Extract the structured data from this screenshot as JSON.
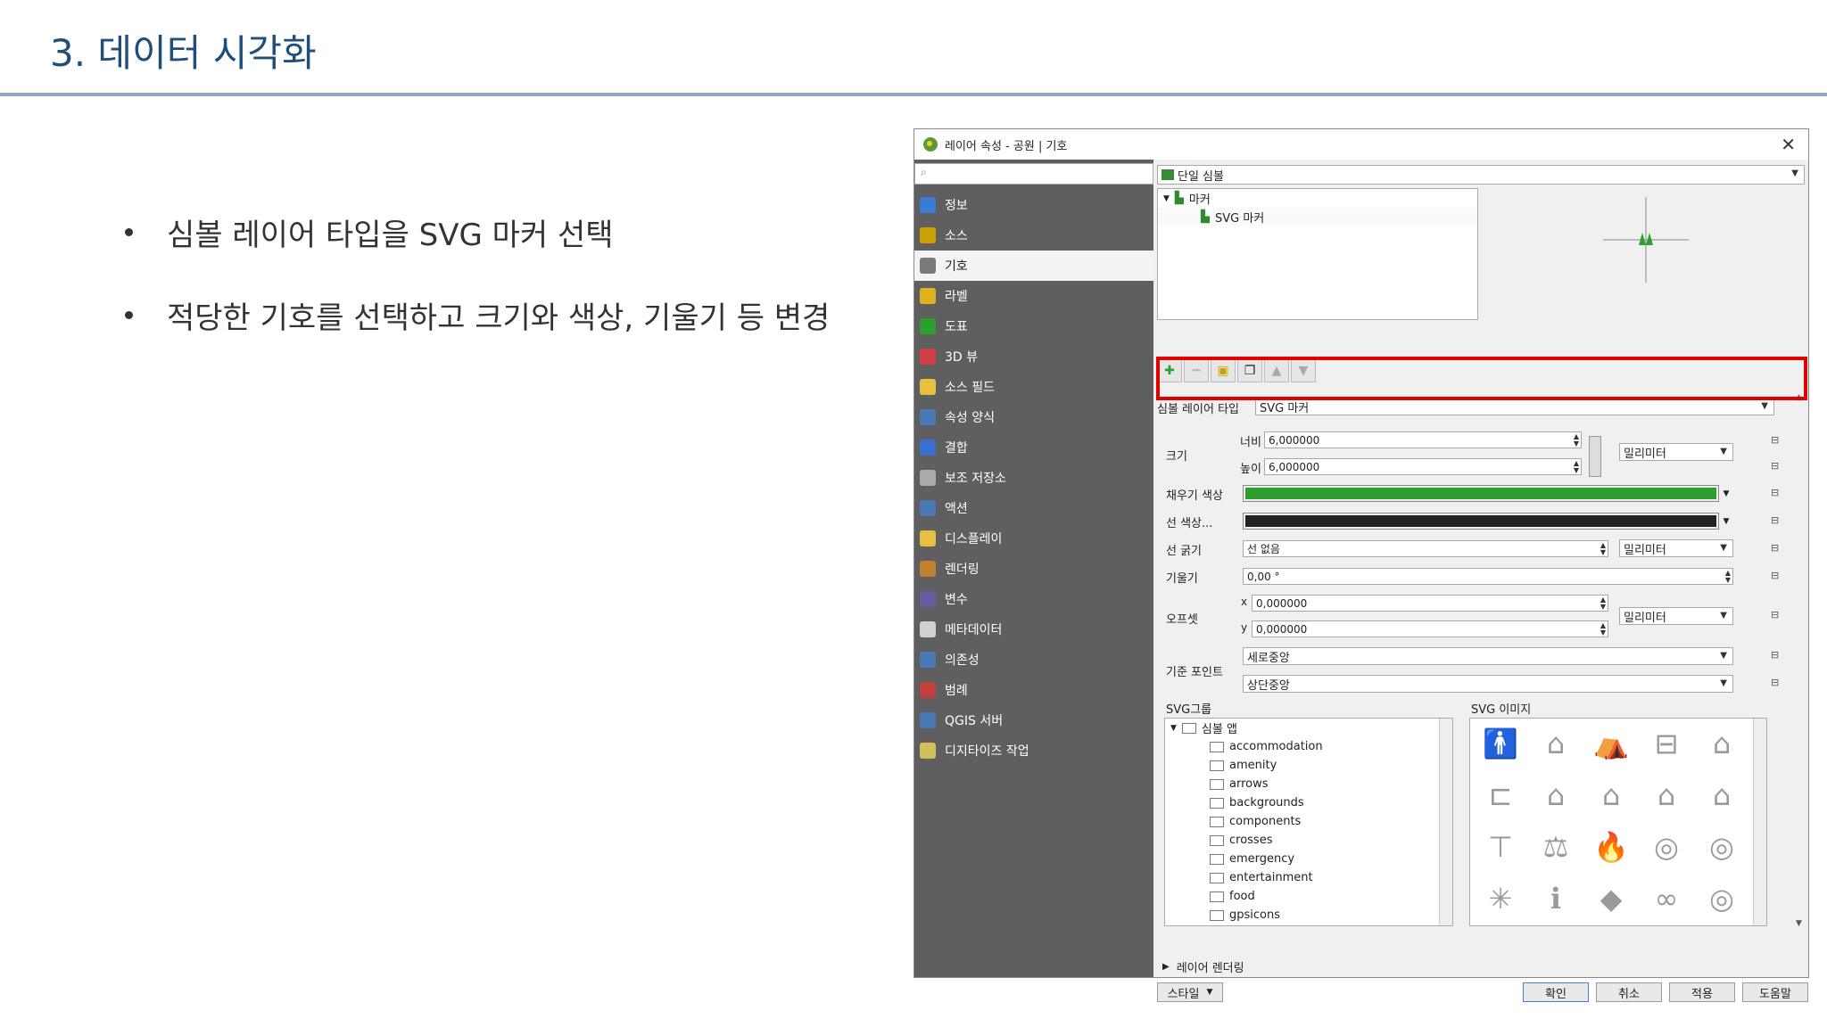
{
  "slide": {
    "title": "3. 데이터 시각화",
    "bullets": [
      "심볼 레이어 타입을 SVG 마커 선택",
      "적당한 기호를 선택하고 크기와 색상, 기울기 등 변경"
    ]
  },
  "dialog": {
    "title": "레이어 속성 - 공원 | 기호",
    "sidebar": [
      "정보",
      "소스",
      "기호",
      "라벨",
      "도표",
      "3D 뷰",
      "소스 필드",
      "속성 양식",
      "결합",
      "보조 저장소",
      "액션",
      "디스플레이",
      "렌더링",
      "변수",
      "메타데이터",
      "의존성",
      "범례",
      "QGIS 서버",
      "디지타이즈 작업"
    ],
    "active_index": 2,
    "renderer": "단일 심볼",
    "tree": {
      "root": "마커",
      "child": "SVG 마커"
    },
    "symbol_layer_type_label": "심볼 레이어 타입",
    "symbol_layer_type_value": "SVG 마커",
    "size_label": "크기",
    "width_label": "너비",
    "width_value": "6,000000",
    "height_label": "높이",
    "height_value": "6,000000",
    "unit": "밀리미터",
    "fill_color_label": "채우기 색상",
    "fill_color": "#2e9e2e",
    "stroke_color_label": "선 색상...",
    "stroke_color": "#222222",
    "stroke_width_label": "선 굵기",
    "stroke_width_value": "선 없음",
    "rotation_label": "기울기",
    "rotation_value": "0,00 °",
    "offset_label": "오프셋",
    "offset_x_label": "x",
    "offset_x": "0,000000",
    "offset_y_label": "y",
    "offset_y": "0,000000",
    "anchor_label": "기준 포인트",
    "anchor_h": "세로중앙",
    "anchor_v": "상단중앙",
    "svg_group_label": "SVG그룹",
    "svg_image_label": "SVG 이미지",
    "svg_groups_root": "심볼 앱",
    "svg_groups": [
      "accommodation",
      "amenity",
      "arrows",
      "backgrounds",
      "components",
      "crosses",
      "emergency",
      "entertainment",
      "food",
      "gpsicons"
    ],
    "layer_rendering": "레이어 렌더링",
    "style_button": "스타일",
    "buttons": {
      "ok": "확인",
      "cancel": "취소",
      "apply": "적용",
      "help": "도움말"
    }
  }
}
